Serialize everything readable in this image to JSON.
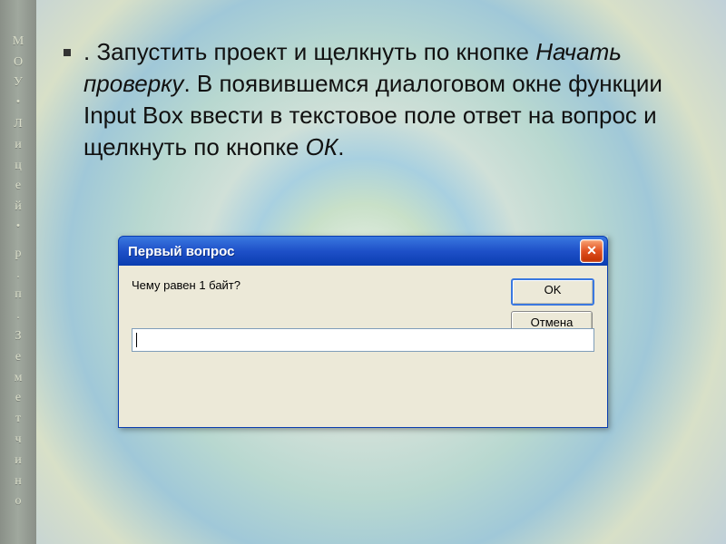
{
  "sidebar": {
    "chars": [
      "М",
      "О",
      "У",
      "・",
      "Л",
      "и",
      "ц",
      "е",
      "й",
      "・",
      " ",
      "р",
      ".",
      "п",
      ".",
      "З",
      "е",
      "м",
      "е",
      "т",
      "ч",
      "и",
      "н",
      "о"
    ]
  },
  "bullet": {
    "leading": ". ",
    "part1": "Запустить проект и щелкнуть по кнопке ",
    "italic1": "Начать проверку",
    "part2": ". В появившемся диалоговом окне функции Input Box ввести в текстовое поле ответ на вопрос и щелкнуть по кнопке ",
    "italic2": "ОК",
    "part3": "."
  },
  "dialog": {
    "title": "Первый вопрос",
    "close_glyph": "✕",
    "prompt": "Чему равен 1 байт?",
    "ok_label": "OK",
    "cancel_label": "Отмена",
    "input_value": ""
  }
}
